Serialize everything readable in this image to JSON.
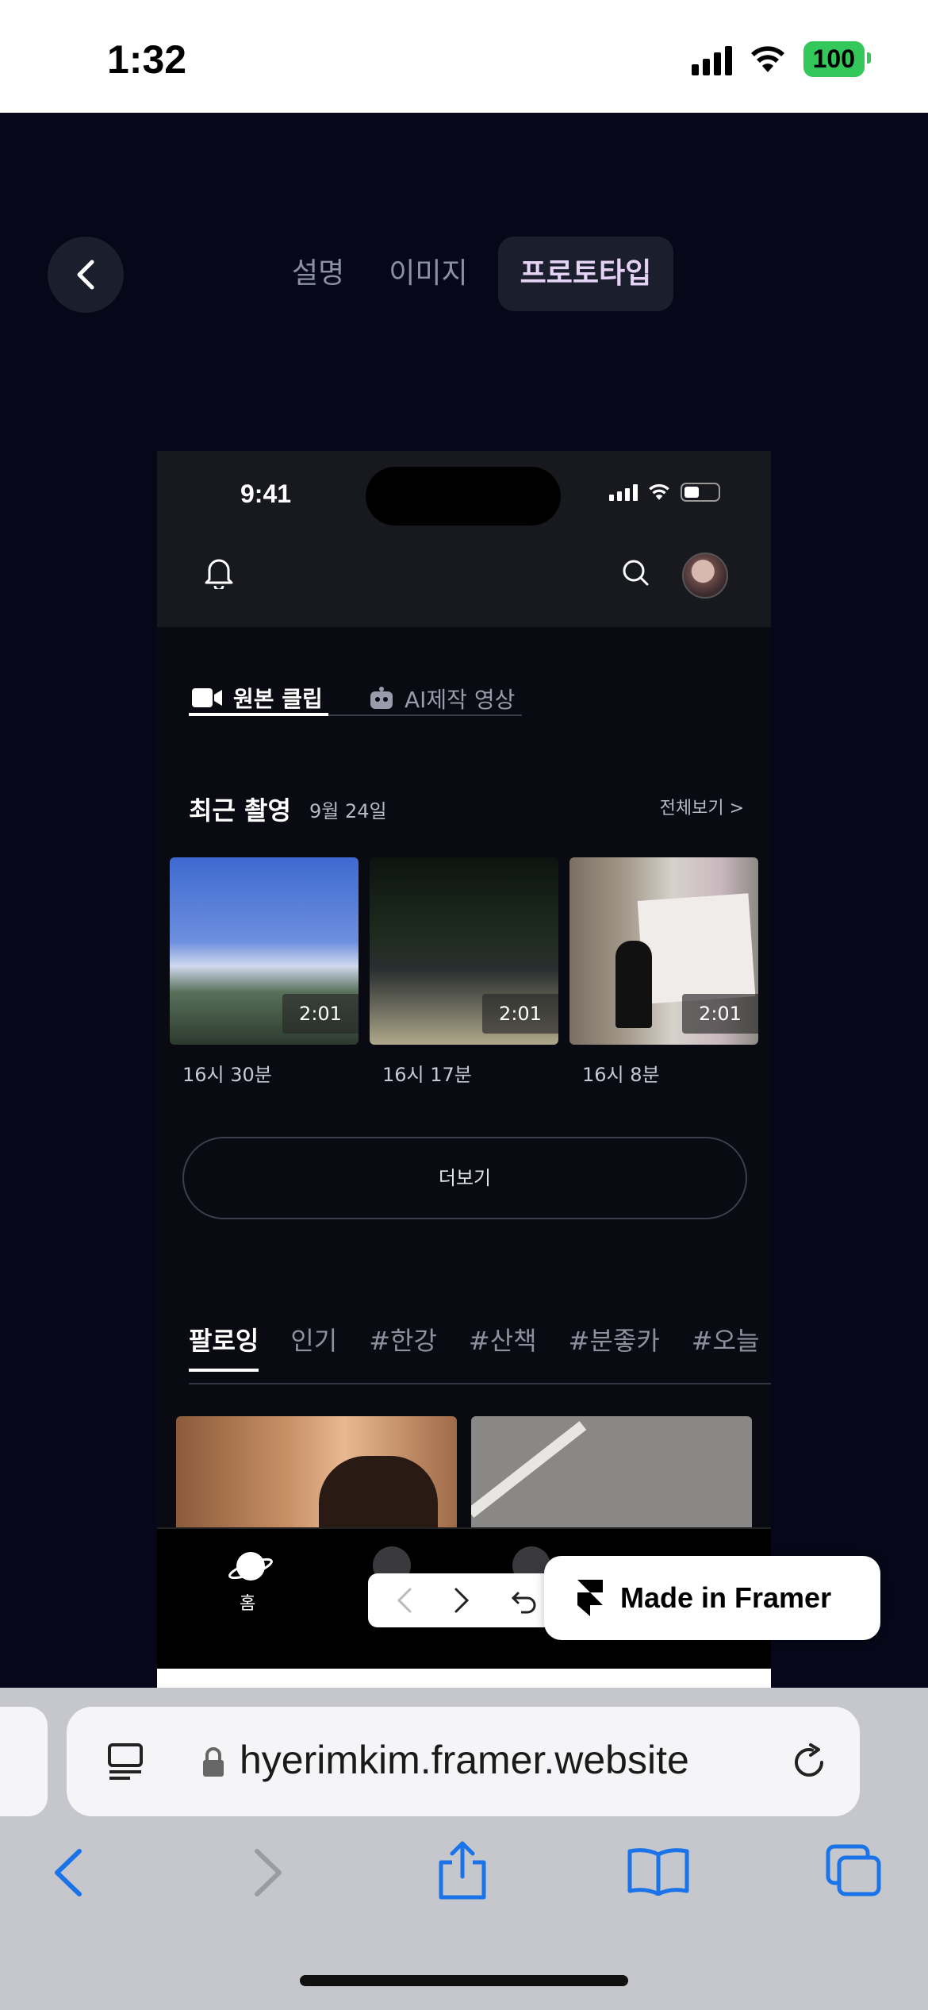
{
  "ios_status": {
    "time": "1:32",
    "battery": "100"
  },
  "top_nav": {
    "tabs": [
      "설명",
      "이미지",
      "프로토타입"
    ],
    "active_index": 2
  },
  "mockup": {
    "status_time": "9:41",
    "content_tabs": {
      "original": "원본 클립",
      "ai": "AI제작 영상"
    },
    "recent": {
      "title": "최근 촬영",
      "date": "9월 24일",
      "see_all": "전체보기 >"
    },
    "clips": [
      {
        "duration": "2:01",
        "time": "16시 30분"
      },
      {
        "duration": "2:01",
        "time": "16시 17분"
      },
      {
        "duration": "2:01",
        "time": "16시 8분"
      }
    ],
    "more_button": "더보기",
    "tags": [
      "팔로잉",
      "인기",
      "#한강",
      "#산책",
      "#분좋카",
      "#오늘"
    ],
    "bottom_nav": {
      "home_label": "홈"
    }
  },
  "framer_badge": "Made in Framer",
  "safari": {
    "url": "hyerimkim.framer.website"
  },
  "colors": {
    "background": "#060819",
    "accent_safari": "#1a73e8",
    "battery": "#34c759"
  }
}
